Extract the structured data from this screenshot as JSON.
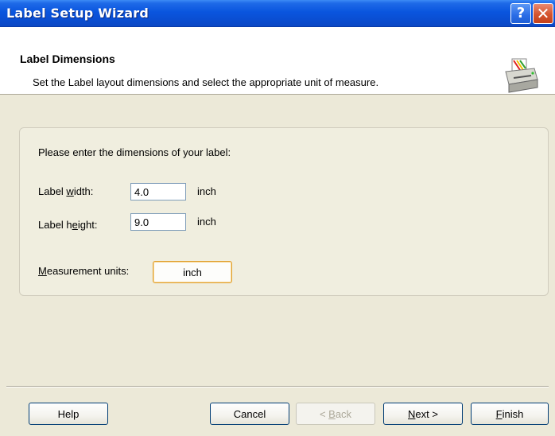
{
  "window": {
    "title": "Label Setup Wizard",
    "help_glyph": "?",
    "close_glyph": "✕"
  },
  "header": {
    "title": "Label Dimensions",
    "subtitle": "Set the Label layout dimensions and select the appropriate unit of measure.",
    "icon": "printer-icon"
  },
  "form": {
    "prompt": "Please enter the dimensions of your label:",
    "width": {
      "label_pre": "Label ",
      "label_key": "w",
      "label_post": "idth:",
      "value": "4.0",
      "unit": "inch"
    },
    "height": {
      "label_pre": "Label h",
      "label_key": "e",
      "label_post": "ight:",
      "value": "9.0",
      "unit": "inch"
    },
    "measurement": {
      "label_key": "M",
      "label_post": "easurement units:",
      "value": "inch"
    }
  },
  "footer": {
    "help": "Help",
    "cancel": "Cancel",
    "back_pre": "< ",
    "back_key": "B",
    "back_post": "ack",
    "next_key": "N",
    "next_post": "ext >",
    "finish_key": "F",
    "finish_post": "inish"
  },
  "colors": {
    "titlebar": "#0a55de",
    "face": "#ece9d8",
    "focus": "#e0a030"
  }
}
